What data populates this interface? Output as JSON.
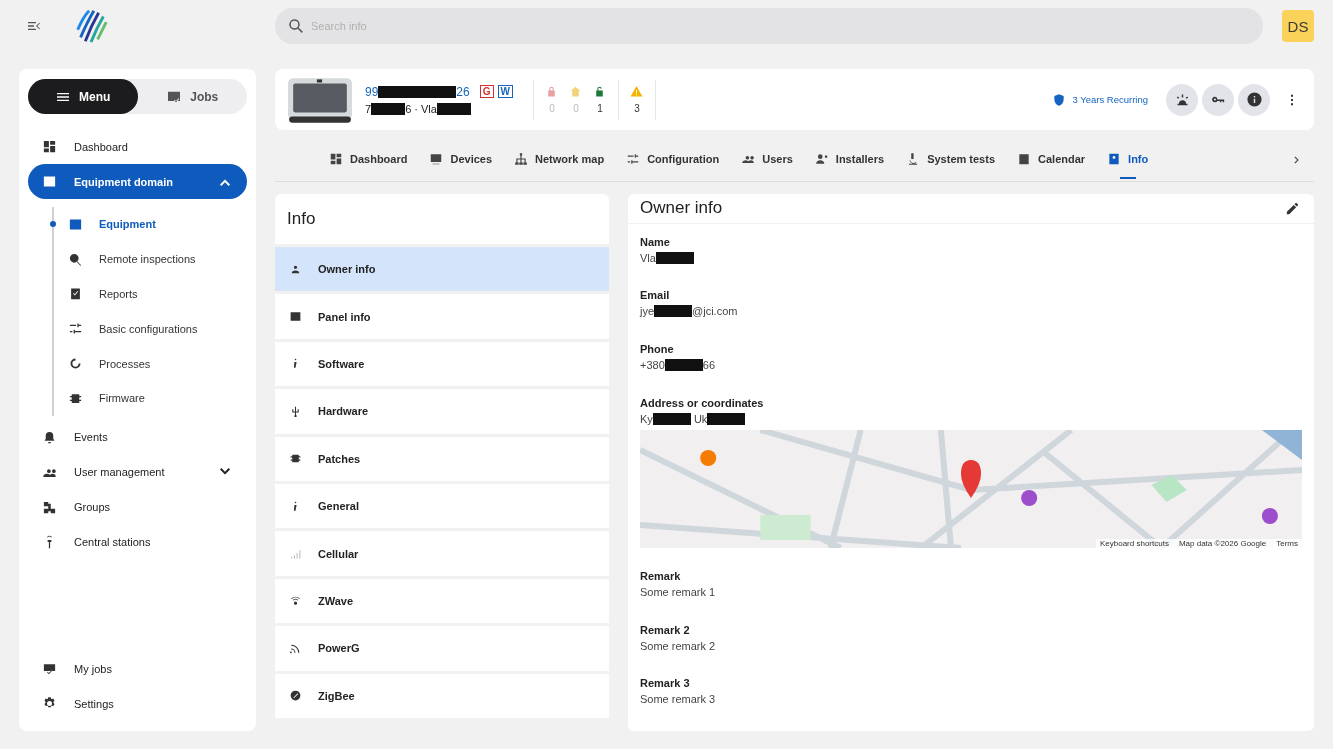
{
  "search": {
    "placeholder": "Search info"
  },
  "user": {
    "initials": "DS"
  },
  "sidebar": {
    "switch": [
      {
        "label": "Menu",
        "selected": true
      },
      {
        "label": "Jobs",
        "selected": false
      }
    ],
    "items": [
      {
        "label": "Dashboard",
        "selected": false
      },
      {
        "label": "Equipment domain",
        "selected": true,
        "expanded": true,
        "children": [
          {
            "label": "Equipment",
            "selected": true
          },
          {
            "label": "Remote inspections",
            "selected": false
          },
          {
            "label": "Reports",
            "selected": false
          },
          {
            "label": "Basic configurations",
            "selected": false
          },
          {
            "label": "Processes",
            "selected": false
          },
          {
            "label": "Firmware",
            "selected": false
          }
        ]
      },
      {
        "label": "Events",
        "selected": false
      },
      {
        "label": "User management",
        "selected": false,
        "expanded": false
      },
      {
        "label": "Groups",
        "selected": false
      },
      {
        "label": "Central stations",
        "selected": false
      }
    ],
    "bottom_items": [
      {
        "label": "My jobs",
        "selected": false
      },
      {
        "label": "Settings",
        "selected": false
      }
    ]
  },
  "device": {
    "serial": [
      {
        "kind": "text",
        "text": "99"
      },
      {
        "kind": "redacted"
      },
      {
        "kind": "text",
        "text": "26"
      }
    ],
    "badges": [
      {
        "text": "G",
        "color": "#d32f2f"
      },
      {
        "text": "W",
        "color": "#1565c0"
      }
    ],
    "subtitle": [
      {
        "kind": "text",
        "text": "7"
      },
      {
        "kind": "redacted"
      },
      {
        "kind": "text",
        "text": "6 · Vla"
      },
      {
        "kind": "redacted"
      }
    ],
    "counters": [
      {
        "count": "0",
        "color": "#e8a0a0"
      },
      {
        "count": "0",
        "color": "#f2d27a"
      },
      {
        "count": "1",
        "color": "#1b7a3a"
      }
    ],
    "warnings": {
      "count": "3"
    },
    "subscription": "3 Years Recurring"
  },
  "tabs": [
    {
      "label": "Dashboard",
      "selected": false
    },
    {
      "label": "Devices",
      "selected": false
    },
    {
      "label": "Network map",
      "selected": false
    },
    {
      "label": "Configuration",
      "selected": false
    },
    {
      "label": "Users",
      "selected": false
    },
    {
      "label": "Installers",
      "selected": false
    },
    {
      "label": "System tests",
      "selected": false
    },
    {
      "label": "Calendar",
      "selected": false
    },
    {
      "label": "Info",
      "selected": true
    }
  ],
  "info": {
    "title": "Info",
    "items": [
      {
        "label": "Owner info",
        "selected": true
      },
      {
        "label": "Panel info",
        "selected": false
      },
      {
        "label": "Software",
        "selected": false
      },
      {
        "label": "Hardware",
        "selected": false
      },
      {
        "label": "Patches",
        "selected": false
      },
      {
        "label": "General",
        "selected": false
      },
      {
        "label": "Cellular",
        "selected": false
      },
      {
        "label": "ZWave",
        "selected": false
      },
      {
        "label": "PowerG",
        "selected": false
      },
      {
        "label": "ZigBee",
        "selected": false
      }
    ]
  },
  "owner": {
    "title": "Owner info",
    "fields": [
      {
        "label": "Name",
        "value": [
          {
            "kind": "text",
            "text": "Vla"
          },
          {
            "kind": "redacted"
          }
        ]
      },
      {
        "label": "Email",
        "value": [
          {
            "kind": "text",
            "text": "jye"
          },
          {
            "kind": "redacted"
          },
          {
            "kind": "text",
            "text": "@jci.com"
          }
        ]
      },
      {
        "label": "Phone",
        "value": [
          {
            "kind": "text",
            "text": "+380"
          },
          {
            "kind": "redacted"
          },
          {
            "kind": "text",
            "text": "66"
          }
        ]
      },
      {
        "label": "Address or coordinates",
        "value": [
          {
            "kind": "text",
            "text": "Ky"
          },
          {
            "kind": "redacted"
          },
          {
            "kind": "text",
            "text": " Uk"
          },
          {
            "kind": "redacted"
          }
        ]
      }
    ],
    "map_footer": [
      "Keyboard shortcuts",
      "Map data ©2026 Google",
      "Terms"
    ],
    "remarks": [
      {
        "label": "Remark",
        "value": "Some remark 1"
      },
      {
        "label": "Remark 2",
        "value": "Some remark 2"
      },
      {
        "label": "Remark 3",
        "value": "Some remark 3"
      }
    ]
  }
}
